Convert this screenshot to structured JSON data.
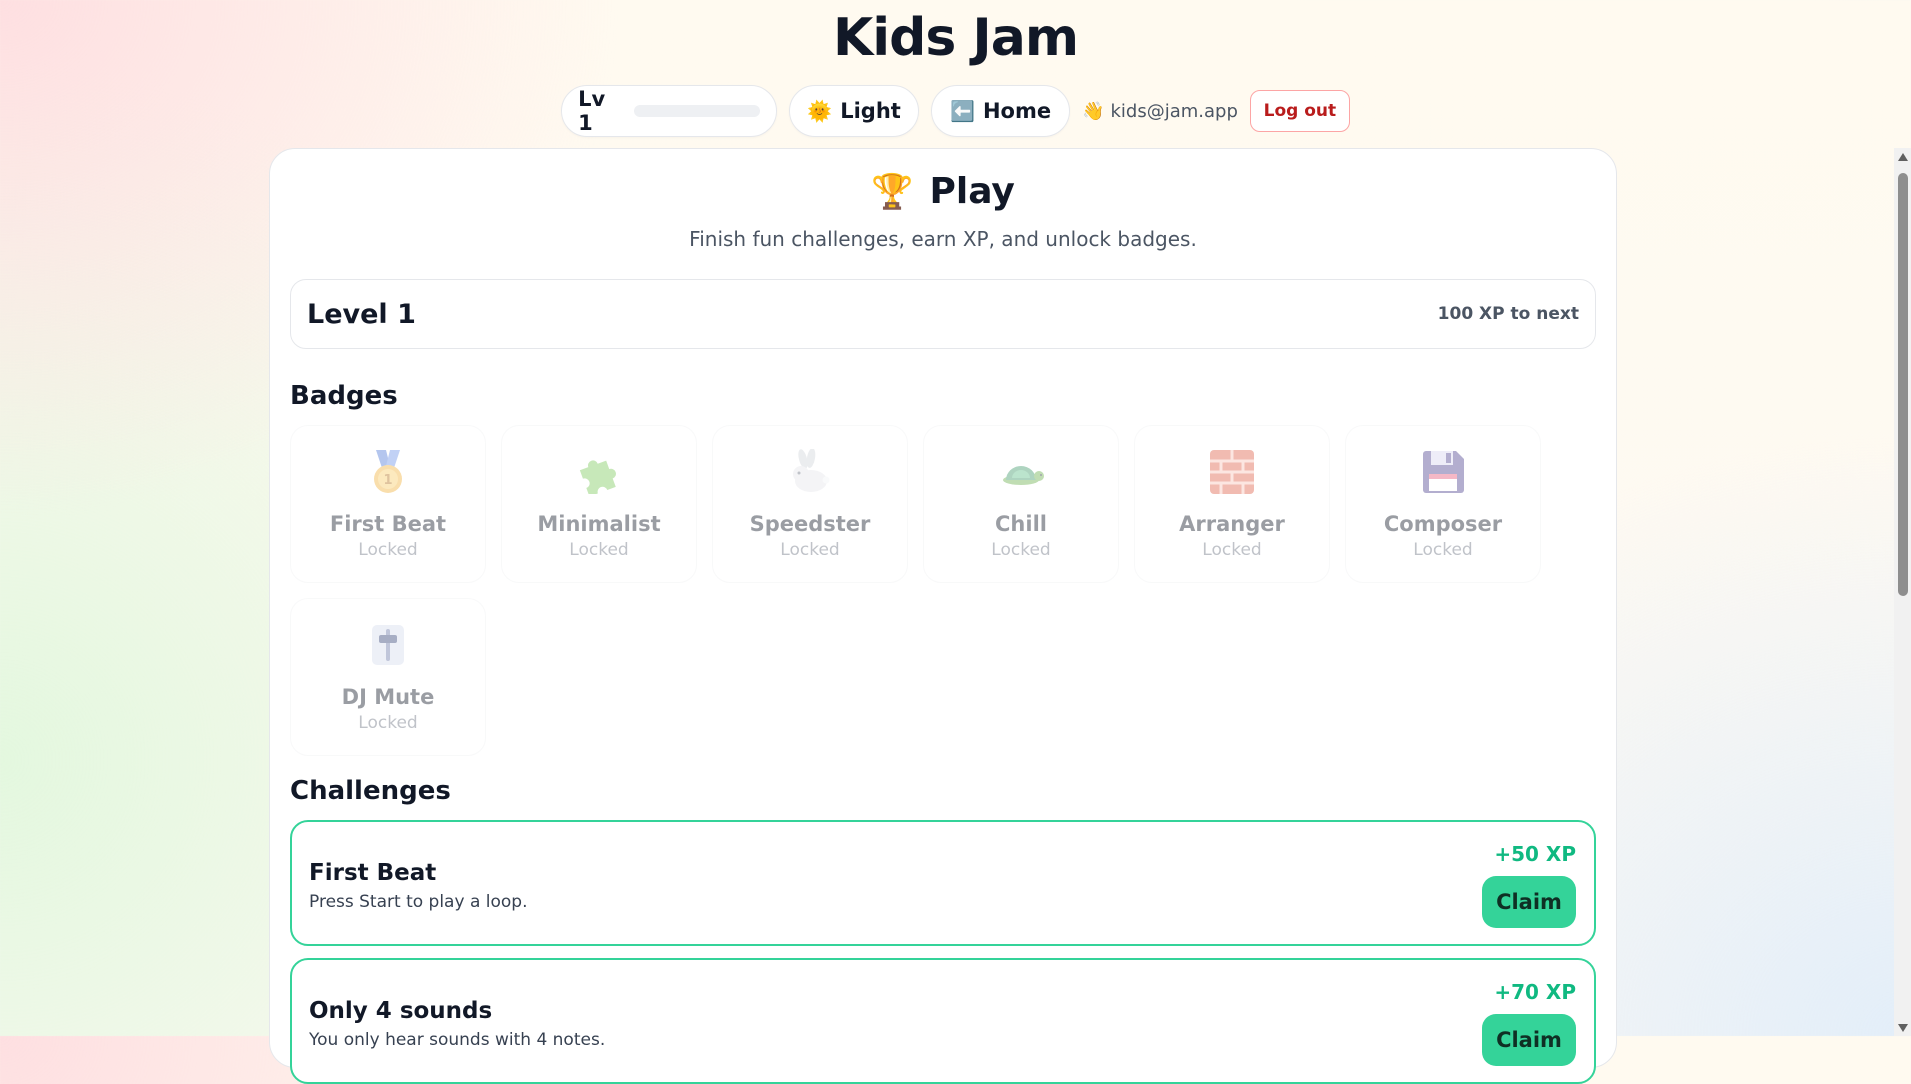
{
  "app": {
    "title": "Kids Jam"
  },
  "topbar": {
    "level_label": "Lv 1",
    "level_progress": 0,
    "theme_emoji": "🌞",
    "theme_label": "Light",
    "home_emoji": "⬅️",
    "home_label": "Home",
    "user_emoji": "👋",
    "user_email": "kids@jam.app",
    "logout_label": "Log out"
  },
  "play": {
    "emoji": "🏆",
    "title": "Play",
    "subtitle": "Finish fun challenges, earn XP, and unlock badges."
  },
  "level_card": {
    "title": "Level 1",
    "next": "100 XP to next"
  },
  "badges": {
    "heading": "Badges",
    "items": [
      {
        "name": "First Beat",
        "status": "Locked",
        "icon": "medal-icon"
      },
      {
        "name": "Minimalist",
        "status": "Locked",
        "icon": "puzzle-icon"
      },
      {
        "name": "Speedster",
        "status": "Locked",
        "icon": "rabbit-icon"
      },
      {
        "name": "Chill",
        "status": "Locked",
        "icon": "turtle-icon"
      },
      {
        "name": "Arranger",
        "status": "Locked",
        "icon": "bricks-icon"
      },
      {
        "name": "Composer",
        "status": "Locked",
        "icon": "floppy-disk-icon"
      },
      {
        "name": "DJ Mute",
        "status": "Locked",
        "icon": "fader-icon"
      }
    ]
  },
  "challenges": {
    "heading": "Challenges",
    "items": [
      {
        "title": "First Beat",
        "desc": "Press Start to play a loop.",
        "xp": "+50 XP",
        "action": "Claim"
      },
      {
        "title": "Only 4 sounds",
        "desc": "You only hear sounds with 4 notes.",
        "xp": "+70 XP",
        "action": "Claim"
      }
    ]
  },
  "colors": {
    "accent": "#34d399",
    "accent_text": "#10b981",
    "danger": "#b91c1c"
  }
}
